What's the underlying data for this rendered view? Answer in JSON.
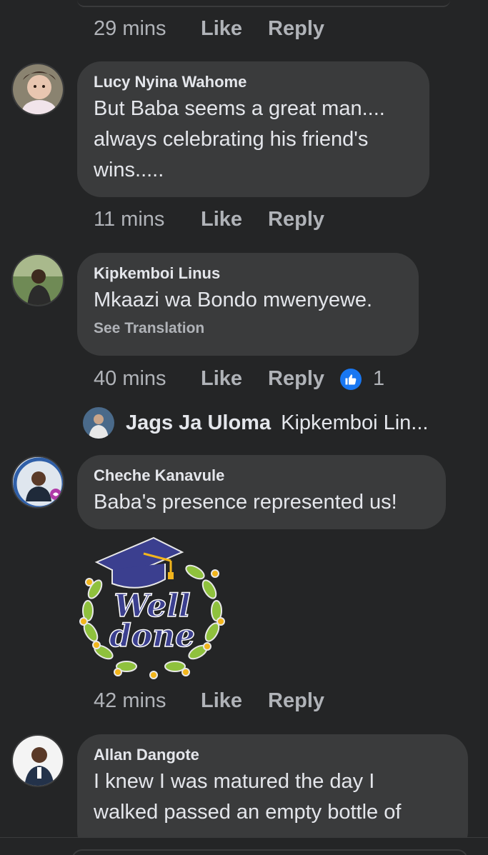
{
  "comments": [
    {
      "time": "29 mins",
      "like_label": "Like",
      "reply_label": "Reply"
    },
    {
      "author": "Lucy Nyina Wahome",
      "text": "But Baba seems a great man....\nalways celebrating his friend's\nwins.....",
      "time": "11 mins",
      "like_label": "Like",
      "reply_label": "Reply"
    },
    {
      "author": "Kipkemboi Linus",
      "text": "Mkaazi wa Bondo mwenyewe.",
      "see_translation": "See Translation",
      "time": "40 mins",
      "like_label": "Like",
      "reply_label": "Reply",
      "reaction_count": "1",
      "reaction_icon": "thumbs-up-icon",
      "reply_preview": {
        "author": "Jags Ja Uloma",
        "text": "Kipkemboi Lin..."
      }
    },
    {
      "author": "Cheche Kanavule",
      "text": "Baba's presence represented us!",
      "sticker_text": "Well done",
      "time": "42 mins",
      "like_label": "Like",
      "reply_label": "Reply"
    },
    {
      "author": "Allan Dangote",
      "text": "I knew I was matured the day I\nwalked passed an empty bottle of"
    }
  ],
  "colors": {
    "background": "#242526",
    "bubble": "#3a3b3c",
    "primary_text": "#e4e6eb",
    "secondary_text": "#b0b3b8",
    "like_blue": "#1877f2"
  }
}
